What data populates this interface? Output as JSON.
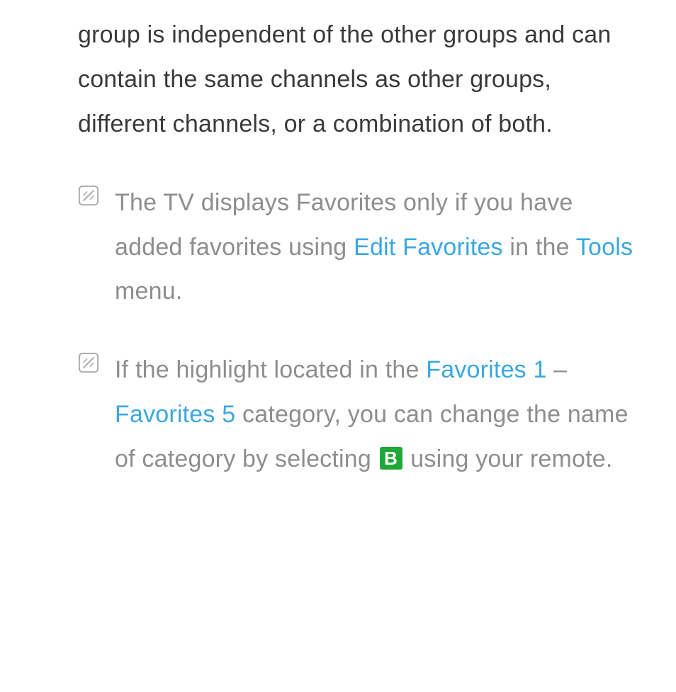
{
  "intro": {
    "text": "group is independent of the other groups and can contain the same channels as other groups, different channels, or a combination of both."
  },
  "note1": {
    "part1": "The TV displays Favorites only if you have added favorites using ",
    "link1": "Edit Favorites",
    "part2": " in the ",
    "link2": "Tools",
    "part3": " menu."
  },
  "note2": {
    "part1": "If the highlight located in the ",
    "link1": "Favorites 1",
    "dash": " – ",
    "link2": "Favorites 5",
    "part2": " category, you can change the name of category by selecting ",
    "button_label": "B",
    "part3": " using your remote."
  }
}
